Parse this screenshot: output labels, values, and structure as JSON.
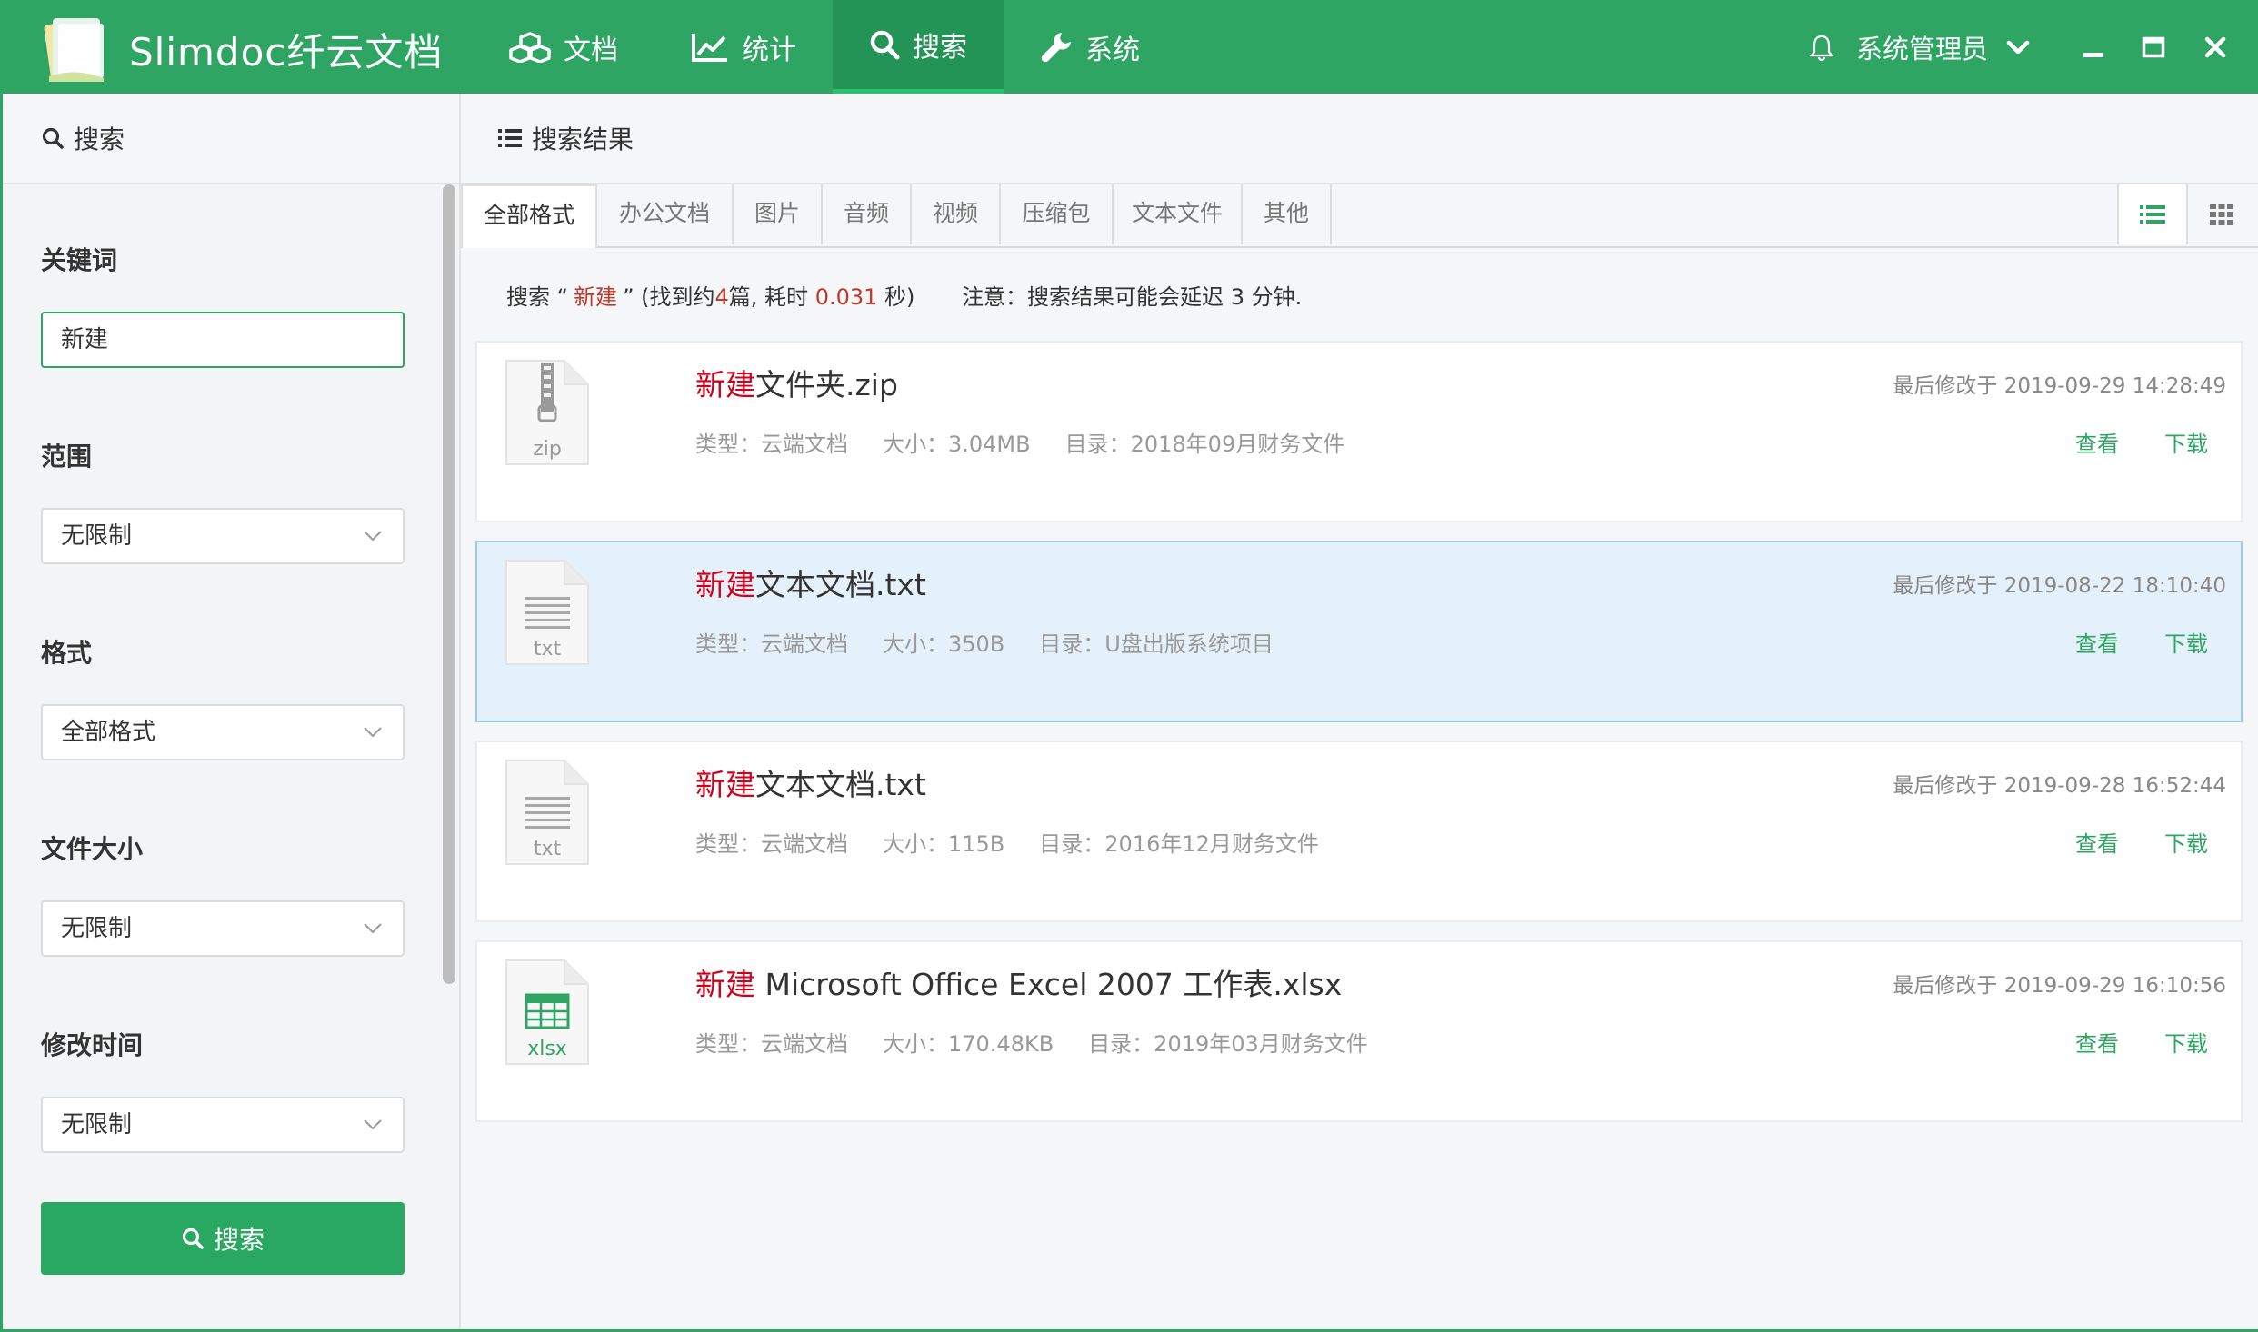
{
  "app": {
    "brand": "Slimdoc纤云文档"
  },
  "nav": [
    {
      "label": "文档",
      "icon": "cubes-icon"
    },
    {
      "label": "统计",
      "icon": "chart-line-icon"
    },
    {
      "label": "搜索",
      "icon": "search-icon",
      "active": true
    },
    {
      "label": "系统",
      "icon": "wrench-icon"
    }
  ],
  "user": {
    "name": "系统管理员"
  },
  "sidebar": {
    "title": "搜索",
    "keyword_label": "关键词",
    "keyword_value": "新建",
    "scope_label": "范围",
    "scope_value": "无限制",
    "format_label": "格式",
    "format_value": "全部格式",
    "size_label": "文件大小",
    "size_value": "无限制",
    "mtime_label": "修改时间",
    "mtime_value": "无限制",
    "search_button": "搜索"
  },
  "main": {
    "title": "搜索结果",
    "tabs": [
      "全部格式",
      "办公文档",
      "图片",
      "音频",
      "视频",
      "压缩包",
      "文本文件",
      "其他"
    ],
    "summary": {
      "prefix": "搜索 “",
      "keyword": "新建",
      "mid1": "” (找到约",
      "count": "4",
      "mid2": "篇, 耗时",
      "time": "0.031",
      "suffix": "秒)",
      "note": "注意：搜索结果可能会延迟 3 分钟."
    },
    "results": [
      {
        "highlight": "新建",
        "rest": "文件夹.zip",
        "ext": "zip",
        "type": "类型：云端文档",
        "size": "大小：3.04MB",
        "dir": "目录：2018年09月财务文件",
        "date": "最后修改于 2019-09-29 14:28:49",
        "view": "查看",
        "download": "下载"
      },
      {
        "highlight": "新建",
        "rest": "文本文档.txt",
        "ext": "txt",
        "type": "类型：云端文档",
        "size": "大小：350B",
        "dir": "目录：U盘出版系统项目",
        "date": "最后修改于 2019-08-22 18:10:40",
        "view": "查看",
        "download": "下载"
      },
      {
        "highlight": "新建",
        "rest": "文本文档.txt",
        "ext": "txt",
        "type": "类型：云端文档",
        "size": "大小：115B",
        "dir": "目录：2016年12月财务文件",
        "date": "最后修改于 2019-09-28 16:52:44",
        "view": "查看",
        "download": "下载"
      },
      {
        "highlight": "新建",
        "rest": " Microsoft Office Excel 2007 工作表.xlsx",
        "ext": "xlsx",
        "type": "类型：云端文档",
        "size": "大小：170.48KB",
        "dir": "目录：2019年03月财务文件",
        "date": "最后修改于 2019-09-29 16:10:56",
        "view": "查看",
        "download": "下载"
      }
    ]
  }
}
